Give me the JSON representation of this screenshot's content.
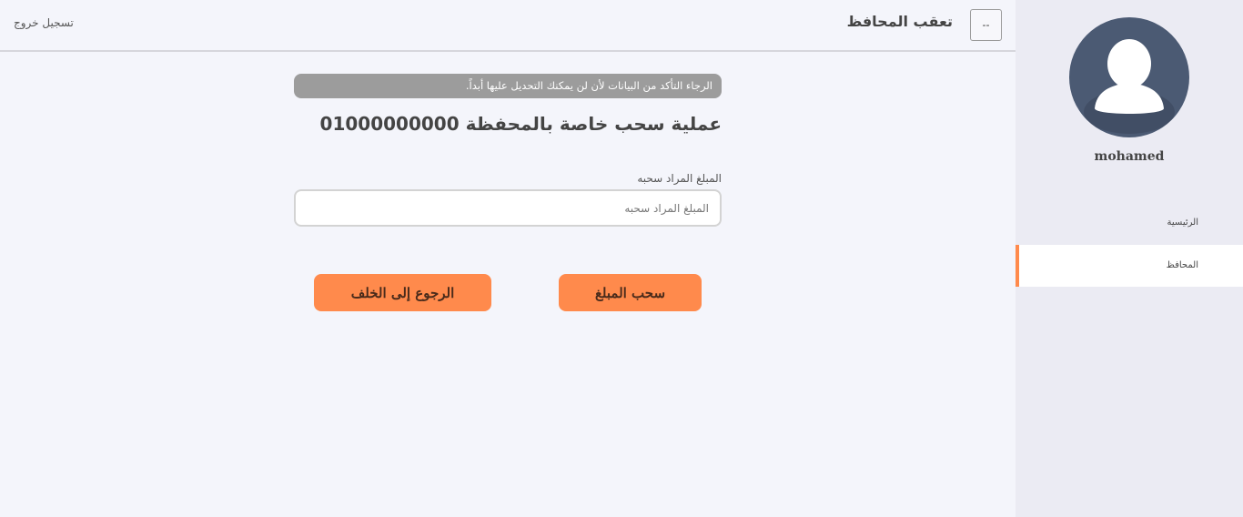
{
  "header": {
    "toggle_label": "--",
    "title": "تعقب المحافظ",
    "logout_label": "تسجيل خروج"
  },
  "sidebar": {
    "avatar_icon": "user-avatar-icon",
    "username": "mohamed",
    "items": [
      {
        "label": "الرئيسية",
        "active": false
      },
      {
        "label": "المحافظ",
        "active": true
      }
    ]
  },
  "main": {
    "alert_text": "الرجاء التأكد من البيانات لأن لن يمكنك التحديل عليها أبداً.",
    "operation_title": "عملية سحب خاصة بالمحفظة 01000000000",
    "amount_label": "المبلغ المراد سحبه",
    "amount_placeholder": "المبلغ المراد سحبه",
    "amount_value": "",
    "withdraw_button": "سحب المبلغ",
    "back_button": "الرجوع إلى الخلف"
  },
  "colors": {
    "accent": "#ff8a4c",
    "avatar_bg": "#4b5a73",
    "alert_bg": "#9c9c9c",
    "page_bg": "#f4f5fb",
    "sidebar_bg": "#ebebf3"
  }
}
